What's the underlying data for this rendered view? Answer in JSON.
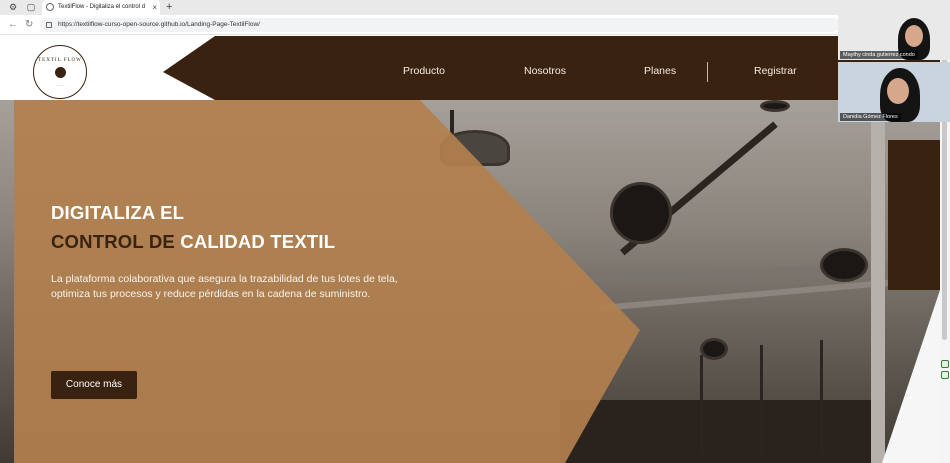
{
  "browser": {
    "tab_title": "TextilFlow - Digitaliza el control d",
    "url": "https://textilflow-curso-open-source.github.io/Landing-Page-TextilFlow/",
    "new_tab_symbol": "+",
    "close_symbol": "×"
  },
  "logo": {
    "text": "TEXTIL FLOW",
    "sub": "· · · ·"
  },
  "nav": {
    "items": [
      "Producto",
      "Nosotros",
      "Planes",
      "Registrar"
    ]
  },
  "hero": {
    "title_line1": "DIGITALIZA EL",
    "title_line2_dark": "CONTROL DE",
    "title_line2_light": " CALIDAD TEXTIL",
    "description": "La plataforma colaborativa que asegura la trazabilidad de tus lotes de tela, optimiza tus procesos y reduce pérdidas en la cadena de suministro.",
    "cta_label": "Conoce más"
  },
  "participants": [
    {
      "name": "Maythy cinda gutierrez condo"
    },
    {
      "name": "Danidia Gómez Flores"
    }
  ],
  "colors": {
    "brand_dark": "#3a2210",
    "overlay_tan": "#b2804e"
  }
}
